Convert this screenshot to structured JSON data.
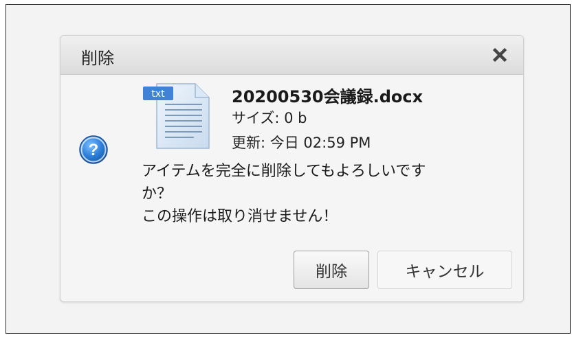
{
  "dialog": {
    "title": "削除",
    "close_icon": "close-icon",
    "question_icon": "question-icon",
    "file": {
      "icon_badge": "txt",
      "name": "20200530会議録.docx",
      "size_line": "サイズ: 0 b",
      "updated_line": "更新: 今日 02:59 PM"
    },
    "message_lines": [
      "アイテムを完全に削除してもよろしいです",
      "か？",
      "この操作は取り消せません！"
    ],
    "buttons": {
      "delete_label": "削除",
      "cancel_label": "キャンセル"
    }
  }
}
